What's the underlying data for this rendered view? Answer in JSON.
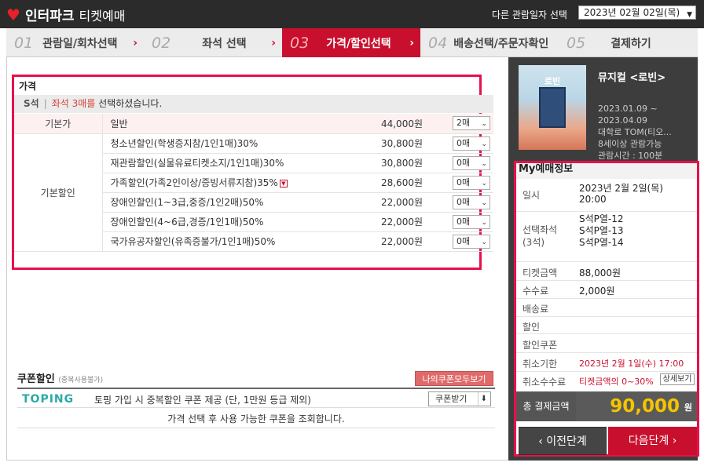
{
  "header": {
    "logo_text": "인터파크",
    "logo_sub": "티켓예매",
    "date_label": "다른 관람일자 선택",
    "date_value": "2023년 02월 02일(목)"
  },
  "steps": [
    {
      "num": "01",
      "label": "관람일/회차선택"
    },
    {
      "num": "02",
      "label": "좌석 선택"
    },
    {
      "num": "03",
      "label": "가격/할인선택"
    },
    {
      "num": "04",
      "label": "배송선택/주문자확인"
    },
    {
      "num": "05",
      "label": "결제하기"
    }
  ],
  "price": {
    "title": "가격",
    "grade": "S석",
    "selected_msg_hl": "좌석 3매를",
    "selected_msg_rest": " 선택하셨습니다.",
    "base_cat": "기본가",
    "discount_cat": "기본할인",
    "rows": [
      {
        "name": "일반",
        "amount": "44,000원",
        "qty": "2매"
      },
      {
        "name": "청소년할인(학생증지참/1인1매)30%",
        "amount": "30,800원",
        "qty": "0매"
      },
      {
        "name": "재관람할인(실물유료티켓소지/1인1매)30%",
        "amount": "30,800원",
        "qty": "0매"
      },
      {
        "name": "가족할인(가족2인이상/증빙서류지참)35%",
        "amount": "28,600원",
        "qty": "0매"
      },
      {
        "name": "장애인할인(1~3급,중증/1인2매)50%",
        "amount": "22,000원",
        "qty": "0매"
      },
      {
        "name": "장애인할인(4~6급,경증/1인1매)50%",
        "amount": "22,000원",
        "qty": "0매"
      },
      {
        "name": "국가유공자할인(유족증불가/1인1매)50%",
        "amount": "22,000원",
        "qty": "0매"
      }
    ]
  },
  "coupon": {
    "title": "쿠폰할인",
    "title_sub": "(중복사용불가)",
    "my_coupon_btn": "나의쿠폰모두보기",
    "partner_logo": "TOPING",
    "desc": "토핑 가입 시 중복할인 쿠폰 제공 (단, 1만원 등급 제외)",
    "get_btn": "쿠폰받기",
    "note": "가격 선택 후 사용 가능한 쿠폰을 조회합니다."
  },
  "show": {
    "poster_title": "로빈",
    "title": "뮤지컬 <로빈>",
    "period_start": "2023.01.09 ~",
    "period_end": "2023.04.09",
    "venue": "대학로 TOM(티오...",
    "age": "8세이상 관람가능",
    "runtime": "관람시간 : 100분"
  },
  "my": {
    "title": "My예매정보",
    "date_lbl": "일시",
    "date_val1": "2023년 2월 2일(목)",
    "date_val2": "20:00",
    "seat_lbl1": "선택좌석",
    "seat_lbl2": "(3석)",
    "seat1": "S석P열-12",
    "seat2": "S석P열-13",
    "seat3": "S석P열-14",
    "ticket_lbl": "티켓금액",
    "ticket_val": "88,000원",
    "fee_lbl": "수수료",
    "fee_val": "2,000원",
    "delivery_lbl": "배송료",
    "discount_lbl": "할인",
    "coupon_lbl": "할인쿠폰",
    "cancel_deadline_lbl": "취소기한",
    "cancel_deadline_val": "2023년 2월 1일(수) 17:00",
    "cancel_fee_lbl": "취소수수료",
    "cancel_fee_val": "티켓금액의 0~30%",
    "detail_btn": "상세보기",
    "total_lbl": "총 결제금액",
    "total_val": "90,000",
    "total_unit": "원",
    "prev_btn": "이전단계",
    "next_btn": "다음단계"
  },
  "colors": {
    "accent": "#c8102e",
    "highlight_border": "#e8104a",
    "total": "#f5c400"
  }
}
